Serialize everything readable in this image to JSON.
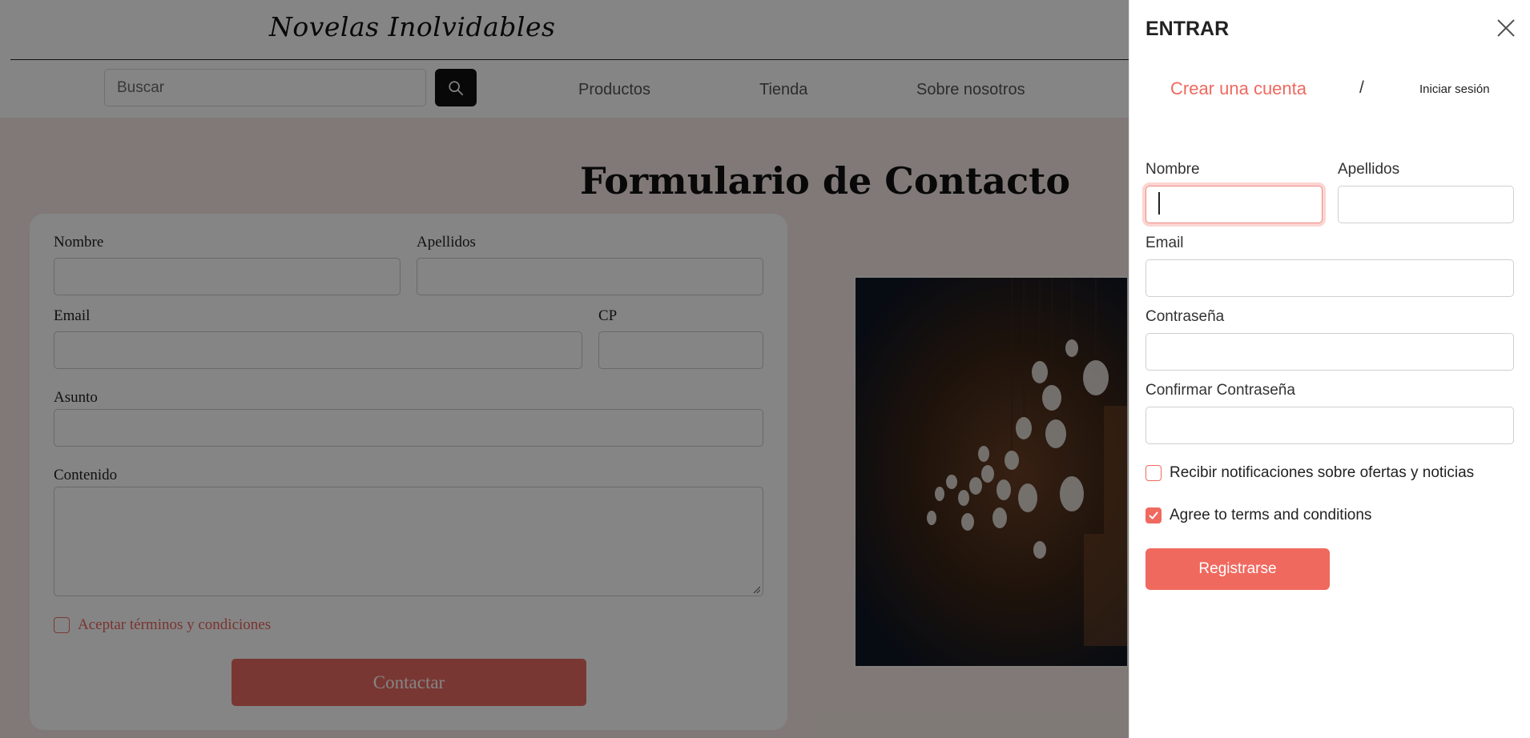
{
  "header": {
    "brand": "Novelas Inolvidables",
    "search_placeholder": "Buscar",
    "nav": [
      {
        "label": "Productos"
      },
      {
        "label": "Tienda"
      },
      {
        "label": "Sobre nosotros"
      }
    ]
  },
  "contact": {
    "title": "Formulario de Contacto",
    "fields": {
      "nombre": "Nombre",
      "apellidos": "Apellidos",
      "email": "Email",
      "cp": "CP",
      "asunto": "Asunto",
      "contenido": "Contenido"
    },
    "terms_label": "Aceptar términos y condiciones",
    "submit_label": "Contactar"
  },
  "drawer": {
    "title": "ENTRAR",
    "tab_create": "Crear una cuenta",
    "tab_separator": "/",
    "tab_login": "Iniciar sesión",
    "labels": {
      "nombre": "Nombre",
      "apellidos": "Apellidos",
      "email": "Email",
      "password": "Contraseña",
      "confirm_password": "Confirmar Contraseña"
    },
    "values": {
      "nombre": "",
      "apellidos": "",
      "email": "",
      "password": "",
      "confirm_password": ""
    },
    "notifications_label": "Recibir notificaciones sobre ofertas y noticias",
    "notifications_checked": false,
    "terms_label": "Agree to terms and conditions",
    "terms_checked": true,
    "submit_label": "Registrarse"
  },
  "colors": {
    "accent": "#f0695f",
    "overlay": "rgba(0,0,0,0.48)"
  },
  "icons": {
    "search": "search-icon",
    "close": "close-icon",
    "check": "check-icon"
  }
}
